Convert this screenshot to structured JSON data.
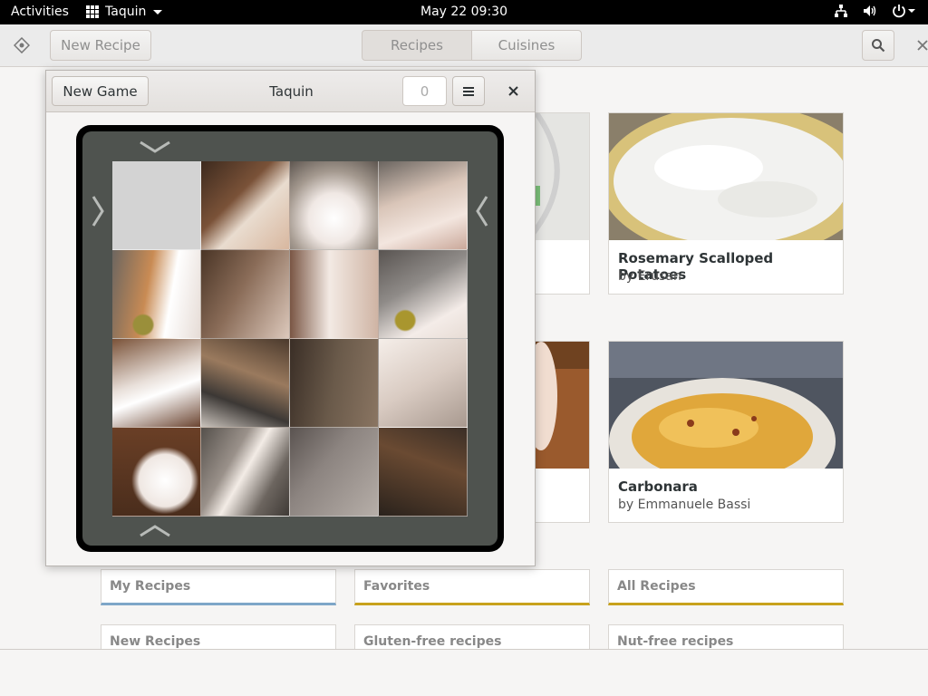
{
  "topbar": {
    "activities": "Activities",
    "app_name": "Taquin",
    "clock": "May 22  09:30"
  },
  "recipes_window": {
    "new_recipe": "New Recipe",
    "tabs": [
      {
        "label": "Recipes",
        "active": true
      },
      {
        "label": "Cuisines",
        "active": false
      }
    ],
    "cards": [
      {
        "title": "Rosemary Scalloped Potatoes",
        "author": "by Erusan"
      },
      {
        "title": "Carbonara",
        "author": "by Emmanuele Bassi"
      }
    ],
    "categories": [
      {
        "label": "My Recipes",
        "accent": "#7ea6c8"
      },
      {
        "label": "Favorites",
        "accent": "#c8a21c"
      },
      {
        "label": "All Recipes",
        "accent": "#c8a21c"
      },
      {
        "label": "New Recipes"
      },
      {
        "label": "Gluten-free recipes"
      },
      {
        "label": "Nut-free recipes"
      }
    ]
  },
  "taquin": {
    "title": "Taquin",
    "new_game": "New Game",
    "moves": "0",
    "menu_icon": "hamburger-menu-icon",
    "close_icon": "close-icon",
    "grid_size": 4,
    "empty_tile_position": [
      0,
      0
    ]
  }
}
